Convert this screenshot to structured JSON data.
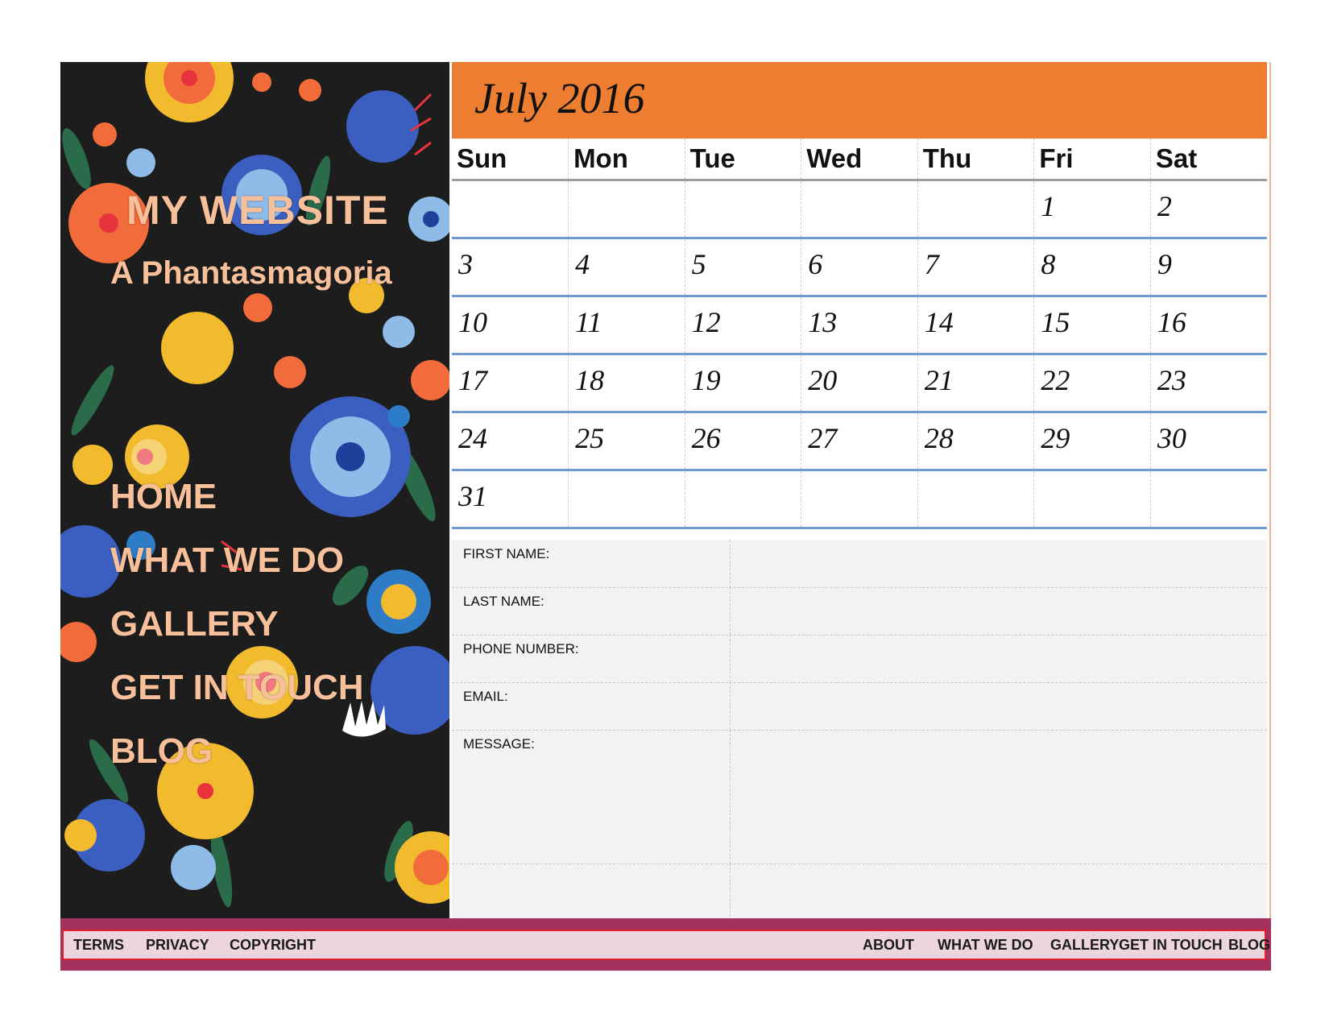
{
  "sidebar": {
    "site_title": "MY WEBSITE",
    "site_subtitle": "A Phantasmagoria",
    "nav": [
      "HOME",
      "WHAT WE DO",
      "GALLERY",
      "GET IN TOUCH",
      "BLOG"
    ]
  },
  "calendar": {
    "title": "July 2016",
    "weekdays": [
      "Sun",
      "Mon",
      "Tue",
      "Wed",
      "Thu",
      "Fri",
      "Sat"
    ],
    "weeks": [
      [
        "",
        "",
        "",
        "",
        "",
        "1",
        "2"
      ],
      [
        "3",
        "4",
        "5",
        "6",
        "7",
        "8",
        "9"
      ],
      [
        "10",
        "11",
        "12",
        "13",
        "14",
        "15",
        "16"
      ],
      [
        "17",
        "18",
        "19",
        "20",
        "21",
        "22",
        "23"
      ],
      [
        "24",
        "25",
        "26",
        "27",
        "28",
        "29",
        "30"
      ],
      [
        "31",
        "",
        "",
        "",
        "",
        "",
        ""
      ]
    ]
  },
  "form": {
    "first_name_label": "FIRST NAME:",
    "last_name_label": "LAST NAME:",
    "phone_label": "PHONE NUMBER:",
    "email_label": "EMAIL:",
    "message_label": "MESSAGE:"
  },
  "footer": {
    "left_links": [
      "TERMS",
      "PRIVACY",
      "COPYRIGHT"
    ],
    "right_links": [
      "ABOUT",
      "WHAT WE DO",
      "GALLERY",
      "GET IN TOUCH",
      "BLOG"
    ]
  },
  "colors": {
    "month_bar": "#ed7d31",
    "sidebar_bg": "#1d1d1d",
    "sidebar_text": "#f7c09a",
    "week_rule": "#6f9bd1",
    "footer_bar": "#a3325f",
    "footer_inner": "#ecd5de",
    "footer_border": "#e0202a"
  },
  "icons": [
    "floral-pattern-decoration"
  ]
}
